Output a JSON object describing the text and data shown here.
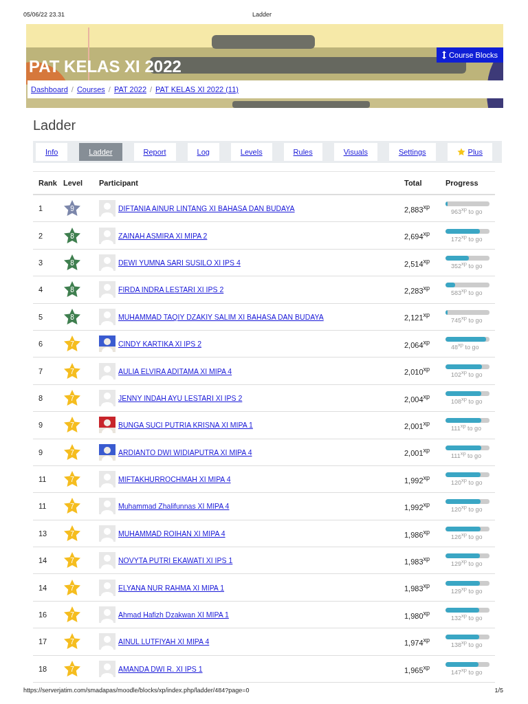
{
  "print_header": {
    "date": "05/06/22 23.31",
    "title": "Ladder"
  },
  "banner": {
    "course_title": "PAT KELAS XI 2022",
    "button": "Course Blocks"
  },
  "breadcrumb": [
    {
      "label": "Dashboard",
      "separator": "/"
    },
    {
      "label": "Courses",
      "separator": "/"
    },
    {
      "label": "PAT 2022",
      "separator": "/"
    },
    {
      "label": "PAT KELAS XI 2022 (11)"
    }
  ],
  "page_title": "Ladder",
  "tabs": [
    {
      "label": "Info",
      "selected": false,
      "kind": "plain"
    },
    {
      "label": "Ladder",
      "selected": true,
      "kind": "plain"
    },
    {
      "label": "Report",
      "selected": false,
      "kind": "plain"
    },
    {
      "label": "Log",
      "selected": false,
      "kind": "plain"
    },
    {
      "label": "Levels",
      "selected": false,
      "kind": "plain"
    },
    {
      "label": "Rules",
      "selected": false,
      "kind": "plain"
    },
    {
      "label": "Visuals",
      "selected": false,
      "kind": "plain"
    },
    {
      "label": "Settings",
      "selected": false,
      "kind": "plain"
    },
    {
      "label": "Plus",
      "selected": false,
      "kind": "star"
    }
  ],
  "table": {
    "columns": [
      "Rank",
      "Level",
      "Participant",
      "Total",
      "Progress"
    ],
    "rows": [
      {
        "rank": "1",
        "level": "9",
        "color": "#7c87ab",
        "kind": "default",
        "name": "DIFTANIA AINUR LINTANG XI BAHASA DAN BUDAYA",
        "total": "2,883$^{xp}$",
        "progress": {
          "level": 0.04
        },
        "to_go": "963$^{xp}$ to go"
      },
      {
        "rank": "2",
        "level": "8",
        "color": "#3f7f4f",
        "kind": "default",
        "name": "ZAINAH ASMIRA XI MIPA 2",
        "total": "2,694$^{xp}$",
        "progress": {
          "level": 0.78
        },
        "to_go": "172$^{xp}$ to go"
      },
      {
        "rank": "3",
        "level": "8",
        "color": "#3f7f4f",
        "kind": "default",
        "name": "DEWI YUMNA SARI SUSILO XI IPS 4",
        "total": "2,514$^{xp}$",
        "progress": {
          "level": 0.53
        },
        "to_go": "352$^{xp}$ to go"
      },
      {
        "rank": "4",
        "level": "8",
        "color": "#3f7f4f",
        "kind": "default",
        "name": "FIRDA INDRA LESTARI XI IPS 2",
        "total": "2,283$^{xp}$",
        "progress": {
          "level": 0.22
        },
        "to_go": "583$^{xp}$ to go"
      },
      {
        "rank": "5",
        "level": "8",
        "color": "#3f7f4f",
        "kind": "default",
        "name": "MUHAMMAD TAQIY DZAKIY SALIM XI BAHASA DAN BUDAYA",
        "total": "2,121$^{xp}$",
        "progress": {
          "level": 0.04
        },
        "to_go": "745$^{xp}$ to go"
      },
      {
        "rank": "6",
        "level": "7",
        "color": "#f5bd1f",
        "kind": "picture",
        "name": "CINDY KARTIKA XI IPS 2",
        "total": "2,064$^{xp}$",
        "progress": {
          "level": 0.92
        },
        "to_go": "48$^{xp}$ to go"
      },
      {
        "rank": "7",
        "level": "7",
        "color": "#f5bd1f",
        "kind": "default",
        "name": "AULIA ELVIRA ADITAMA XI MIPA 4",
        "total": "2,010$^{xp}$",
        "progress": {
          "level": 0.83
        },
        "to_go": "102$^{xp}$ to go"
      },
      {
        "rank": "8",
        "level": "7",
        "color": "#f5bd1f",
        "kind": "default",
        "name": "JENNY INDAH AYU LESTARI XI IPS 2",
        "total": "2,004$^{xp}$",
        "progress": {
          "level": 0.82
        },
        "to_go": "108$^{xp}$ to go"
      },
      {
        "rank": "9",
        "level": "7",
        "color": "#f5bd1f",
        "kind": "picture",
        "name": "BUNGA SUCI PUTRIA KRISNA XI MIPA 1",
        "total": "2,001$^{xp}$",
        "progress": {
          "level": 0.81
        },
        "to_go": "111$^{xp}$ to go"
      },
      {
        "rank": "9",
        "level": "7",
        "color": "#f5bd1f",
        "kind": "picture",
        "name": "ARDIANTO DWI WIDIAPUTRA XI MIPA 4",
        "total": "2,001$^{xp}$",
        "progress": {
          "level": 0.81
        },
        "to_go": "111$^{xp}$ to go"
      },
      {
        "rank": "11",
        "level": "7",
        "color": "#f5bd1f",
        "kind": "default",
        "name": "MIFTAKHURROCHMAH XI MIPA 4",
        "total": "1,992$^{xp}$",
        "progress": {
          "level": 0.8
        },
        "to_go": "120$^{xp}$ to go"
      },
      {
        "rank": "11",
        "level": "7",
        "color": "#f5bd1f",
        "kind": "default",
        "name": "Muhammad Zhalifunnas XI MIPA 4",
        "total": "1,992$^{xp}$",
        "progress": {
          "level": 0.8
        },
        "to_go": "120$^{xp}$ to go"
      },
      {
        "rank": "13",
        "level": "7",
        "color": "#f5bd1f",
        "kind": "default",
        "name": "MUHAMMAD ROIHAN XI MIPA 4",
        "total": "1,986$^{xp}$",
        "progress": {
          "level": 0.79
        },
        "to_go": "126$^{xp}$ to go"
      },
      {
        "rank": "14",
        "level": "7",
        "color": "#f5bd1f",
        "kind": "default",
        "name": "NOVYTA PUTRI EKAWATI XI IPS 1",
        "total": "1,983$^{xp}$",
        "progress": {
          "level": 0.78
        },
        "to_go": "129$^{xp}$ to go"
      },
      {
        "rank": "14",
        "level": "7",
        "color": "#f5bd1f",
        "kind": "default",
        "name": "ELYANA NUR RAHMA XI MIPA 1",
        "total": "1,983$^{xp}$",
        "progress": {
          "level": 0.78
        },
        "to_go": "129$^{xp}$ to go"
      },
      {
        "rank": "16",
        "level": "7",
        "color": "#f5bd1f",
        "kind": "default",
        "name": "Ahmad Hafizh Dzakwan XI MIPA 1",
        "total": "1,980$^{xp}$",
        "progress": {
          "level": 0.77
        },
        "to_go": "132$^{xp}$ to go"
      },
      {
        "rank": "17",
        "level": "7",
        "color": "#f5bd1f",
        "kind": "default",
        "name": "AINUL LUTFIYAH XI MIPA 4",
        "total": "1,974$^{xp}$",
        "progress": {
          "level": 0.76
        },
        "to_go": "138$^{xp}$ to go"
      },
      {
        "rank": "18",
        "level": "7",
        "color": "#f5bd1f",
        "kind": "default",
        "name": "AMANDA DWI R. XI IPS 1",
        "total": "1,965$^{xp}$",
        "progress": {
          "level": 0.75
        },
        "to_go": "147$^{xp}$ to go"
      }
    ]
  },
  "print_footer": {
    "url": "https://serverjatim.com/smadapas/moodle/blocks/xp/index.php/ladder/484?page=0",
    "page": "1/5"
  }
}
